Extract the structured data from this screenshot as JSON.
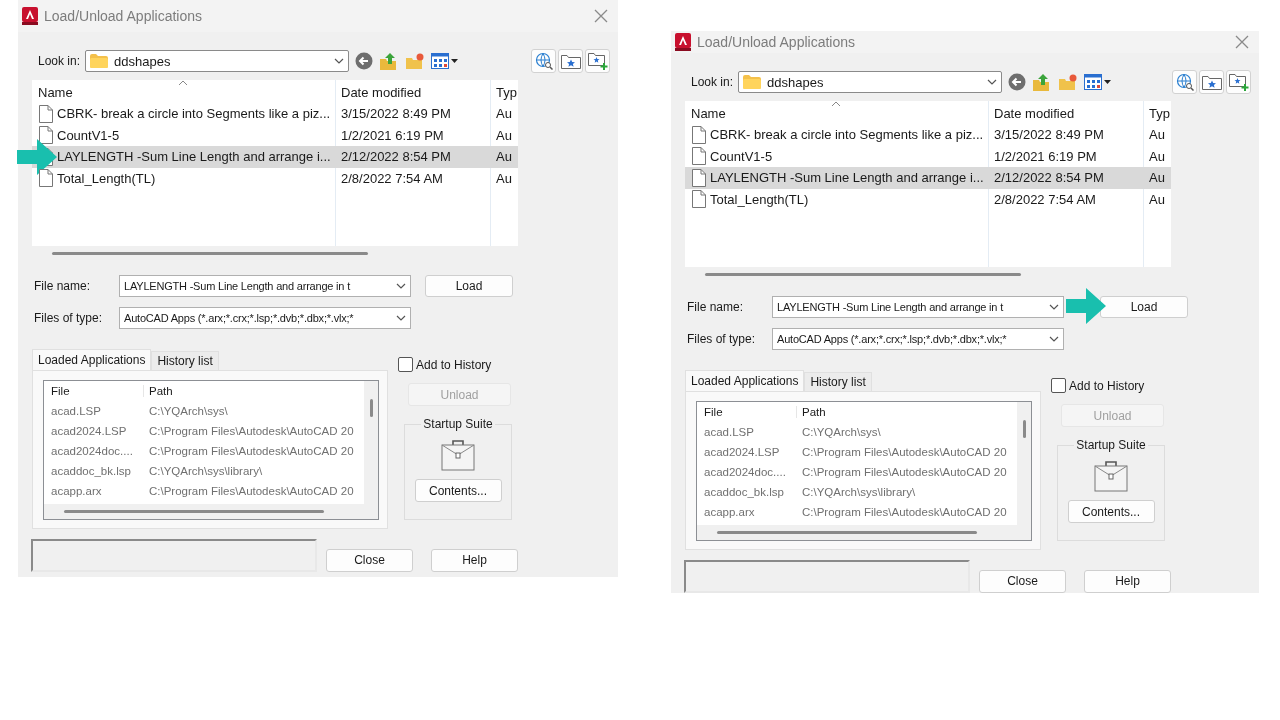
{
  "dialogs": [
    {
      "title": "Load/Unload Applications",
      "look_in": {
        "label": "Look in:",
        "value": "ddshapes"
      },
      "file_list": {
        "columns": [
          "Name",
          "Date modified",
          "Typ"
        ],
        "rows": [
          {
            "name": "CBRK- break a circle into Segments like a piz...",
            "date": "3/15/2022 8:49 PM",
            "type": "Au",
            "selected": false,
            "callout": false
          },
          {
            "name": "CountV1-5",
            "date": "1/2/2021 6:19 PM",
            "type": "Au",
            "selected": false,
            "callout": false
          },
          {
            "name": "LAYLENGTH -Sum Line Length and arrange i...",
            "date": "2/12/2022 8:54 PM",
            "type": "Au",
            "selected": true,
            "callout": true
          },
          {
            "name": "Total_Length(TL)",
            "date": "2/8/2022 7:54 AM",
            "type": "Au",
            "selected": false,
            "callout": false
          }
        ]
      },
      "file_name": {
        "label": "File name:",
        "value": "LAYLENGTH -Sum Line Length and arrange in t"
      },
      "files_of_type": {
        "label": "Files of type:",
        "value": "AutoCAD Apps (*.arx;*.crx;*.lsp;*.dvb;*.dbx;*.vlx;*"
      },
      "load_button": {
        "label": "Load",
        "callout": false
      },
      "tabs": [
        {
          "label": "Loaded Applications",
          "selected": true
        },
        {
          "label": "History list",
          "selected": false
        }
      ],
      "loaded_list": {
        "columns": [
          "File",
          "Path"
        ],
        "rows": [
          {
            "file": "acad.LSP",
            "path": "C:\\YQArch\\sys\\"
          },
          {
            "file": "acad2024.LSP",
            "path": "C:\\Program Files\\Autodesk\\AutoCAD 20"
          },
          {
            "file": "acad2024doc....",
            "path": "C:\\Program Files\\Autodesk\\AutoCAD 20"
          },
          {
            "file": "acaddoc_bk.lsp",
            "path": "C:\\YQArch\\sys\\library\\"
          },
          {
            "file": "acapp.arx",
            "path": "C:\\Program Files\\Autodesk\\AutoCAD 20"
          }
        ]
      },
      "add_to_history": {
        "label": "Add to History",
        "checked": false
      },
      "unload_button": {
        "label": "Unload",
        "disabled": true
      },
      "startup_suite": {
        "title": "Startup Suite",
        "button": "Contents..."
      },
      "close_button": "Close",
      "help_button": "Help"
    },
    {
      "title": "Load/Unload Applications",
      "look_in": {
        "label": "Look in:",
        "value": "ddshapes"
      },
      "file_list": {
        "columns": [
          "Name",
          "Date modified",
          "Typ"
        ],
        "rows": [
          {
            "name": "CBRK- break a circle into Segments like a piz...",
            "date": "3/15/2022 8:49 PM",
            "type": "Au",
            "selected": false,
            "callout": false
          },
          {
            "name": "CountV1-5",
            "date": "1/2/2021 6:19 PM",
            "type": "Au",
            "selected": false,
            "callout": false
          },
          {
            "name": "LAYLENGTH -Sum Line Length and arrange i...",
            "date": "2/12/2022 8:54 PM",
            "type": "Au",
            "selected": true,
            "callout": false
          },
          {
            "name": "Total_Length(TL)",
            "date": "2/8/2022 7:54 AM",
            "type": "Au",
            "selected": false,
            "callout": false
          }
        ]
      },
      "file_name": {
        "label": "File name:",
        "value": "LAYLENGTH -Sum Line Length and arrange in t"
      },
      "files_of_type": {
        "label": "Files of type:",
        "value": "AutoCAD Apps (*.arx;*.crx;*.lsp;*.dvb;*.dbx;*.vlx;*"
      },
      "load_button": {
        "label": "Load",
        "callout": true
      },
      "tabs": [
        {
          "label": "Loaded Applications",
          "selected": true
        },
        {
          "label": "History list",
          "selected": false
        }
      ],
      "loaded_list": {
        "columns": [
          "File",
          "Path"
        ],
        "rows": [
          {
            "file": "acad.LSP",
            "path": "C:\\YQArch\\sys\\"
          },
          {
            "file": "acad2024.LSP",
            "path": "C:\\Program Files\\Autodesk\\AutoCAD 20"
          },
          {
            "file": "acad2024doc....",
            "path": "C:\\Program Files\\Autodesk\\AutoCAD 20"
          },
          {
            "file": "acaddoc_bk.lsp",
            "path": "C:\\YQArch\\sys\\library\\"
          },
          {
            "file": "acapp.arx",
            "path": "C:\\Program Files\\Autodesk\\AutoCAD 20"
          }
        ]
      },
      "add_to_history": {
        "label": "Add to History",
        "checked": false
      },
      "unload_button": {
        "label": "Unload",
        "disabled": true
      },
      "startup_suite": {
        "title": "Startup Suite",
        "button": "Contents..."
      },
      "close_button": "Close",
      "help_button": "Help"
    }
  ]
}
